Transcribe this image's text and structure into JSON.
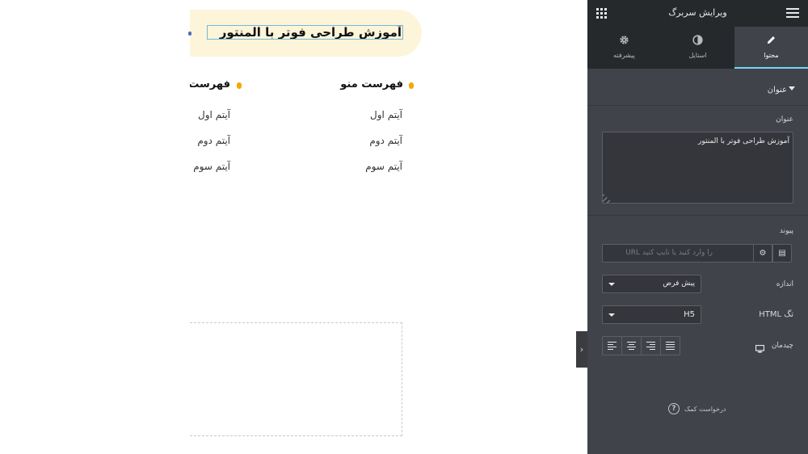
{
  "canvas": {
    "heading": "آموزش طراحی فوتر با المنتور",
    "menus": [
      {
        "title": "فهرست منو",
        "items": [
          "آیتم اول",
          "آیتم دوم",
          "آیتم سوم"
        ]
      },
      {
        "title": "فهرست",
        "items": [
          "آیتم اول",
          "آیتم دوم",
          "آیتم سوم"
        ]
      }
    ]
  },
  "panel": {
    "title": "ویرایش سربرگ",
    "tabs": [
      {
        "label": "محتوا",
        "icon": "pencil-icon"
      },
      {
        "label": "استایل",
        "icon": "contrast-icon"
      },
      {
        "label": "پیشرفته",
        "icon": "gear-icon"
      }
    ],
    "section_title": "عنوان",
    "fields": {
      "title_label": "عنوان",
      "title_value": "آموزش طراحی فوتر با المنتور",
      "link_label": "پیوند",
      "link_placeholder": "را وارد کنید یا تایپ کنید URL",
      "size_label": "اندازه",
      "size_value": "پیش فرض",
      "html_tag_label": "تگ HTML",
      "html_tag_value": "H5",
      "alignment_label": "چیدمان"
    },
    "help_text": "درخواست کمک"
  },
  "colors": {
    "panel_bg": "#404349",
    "panel_header_bg": "#26292c",
    "accent": "#71d7f7",
    "bullet": "#f2a900",
    "heading_bg": "#fcf5da"
  }
}
